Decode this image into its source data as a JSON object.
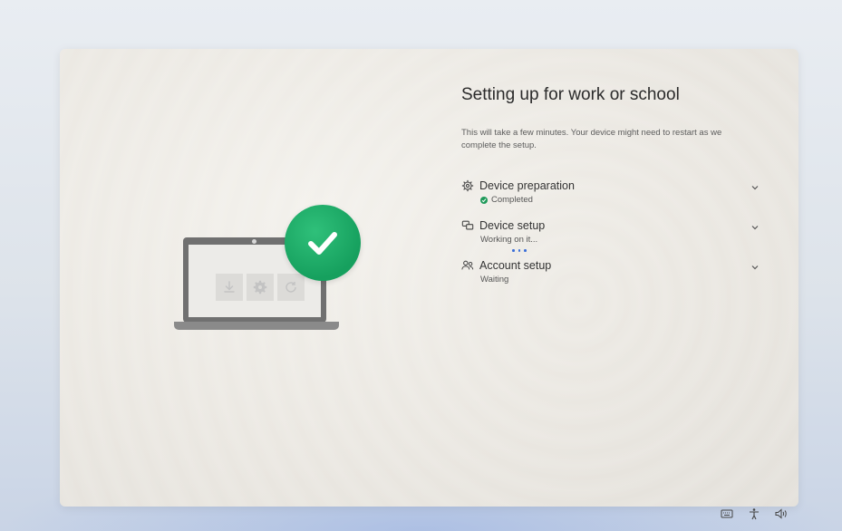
{
  "setup": {
    "title": "Setting up for work or school",
    "description": "This will take a few minutes. Your device might need to restart as we complete the setup.",
    "steps": [
      {
        "label": "Device preparation",
        "status": "Completed",
        "icon": "gear-icon",
        "state": "completed"
      },
      {
        "label": "Device setup",
        "status": "Working on it...",
        "icon": "device-setup-icon",
        "state": "in-progress"
      },
      {
        "label": "Account setup",
        "status": "Waiting",
        "icon": "people-icon",
        "state": "waiting"
      }
    ]
  },
  "illustration": {
    "tiles": [
      "download-icon",
      "gear-icon",
      "restart-icon"
    ],
    "badge": "checkmark-icon"
  },
  "tray": {
    "icons": [
      "keyboard-icon",
      "accessibility-icon",
      "volume-icon"
    ]
  },
  "colors": {
    "success": "#1f9a5a",
    "badge": "#16a05e",
    "progress": "#3b6fd8"
  }
}
